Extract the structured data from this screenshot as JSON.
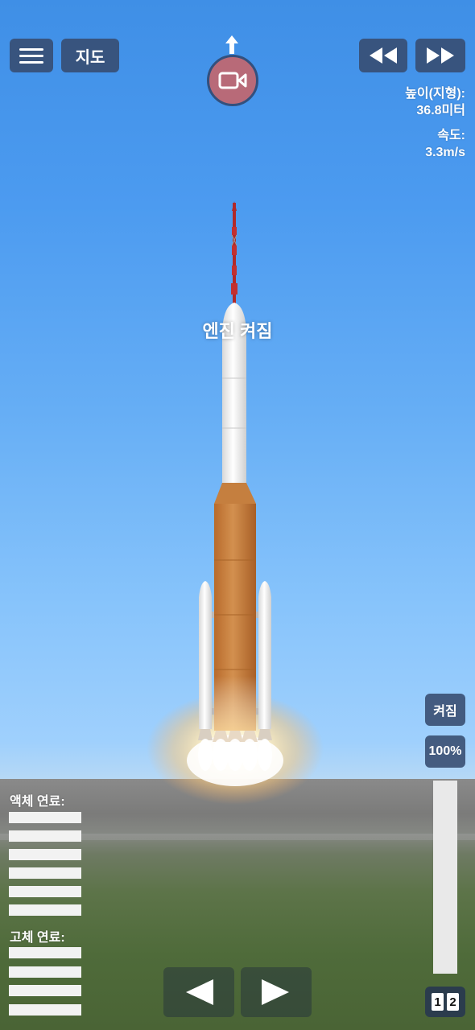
{
  "toolbar": {
    "map_label": "지도",
    "menu_icon": "hamburger-menu-icon",
    "camera_icon": "video-camera-icon",
    "rewind_icon": "rewind-icon",
    "fast_forward_icon": "fast-forward-icon"
  },
  "stats": {
    "altitude_label": "높이(지형):",
    "altitude_value": "36.8미터",
    "speed_label": "속도:",
    "speed_value": "3.3m/s"
  },
  "status_message": "엔진 켜짐",
  "engine": {
    "toggle_label": "켜짐",
    "throttle_label": "100%",
    "throttle_level": 1.0
  },
  "fuel": {
    "liquid_label": "액체 연료:",
    "solid_label": "고체 연료:",
    "liquid_levels": [
      1,
      1,
      1,
      1,
      1,
      1
    ],
    "solid_levels": [
      1,
      1,
      1,
      1
    ]
  },
  "stages": [
    "1",
    "2"
  ],
  "controls": {
    "left_icon": "rotate-left-arrow-icon",
    "right_icon": "rotate-right-arrow-icon"
  },
  "colors": {
    "button_bg": "#374b6e",
    "camera_button": "#b86a78",
    "sky_top": "#3f8fe6",
    "ground": "#4f6b3a",
    "core_stage": "#c9823f"
  }
}
